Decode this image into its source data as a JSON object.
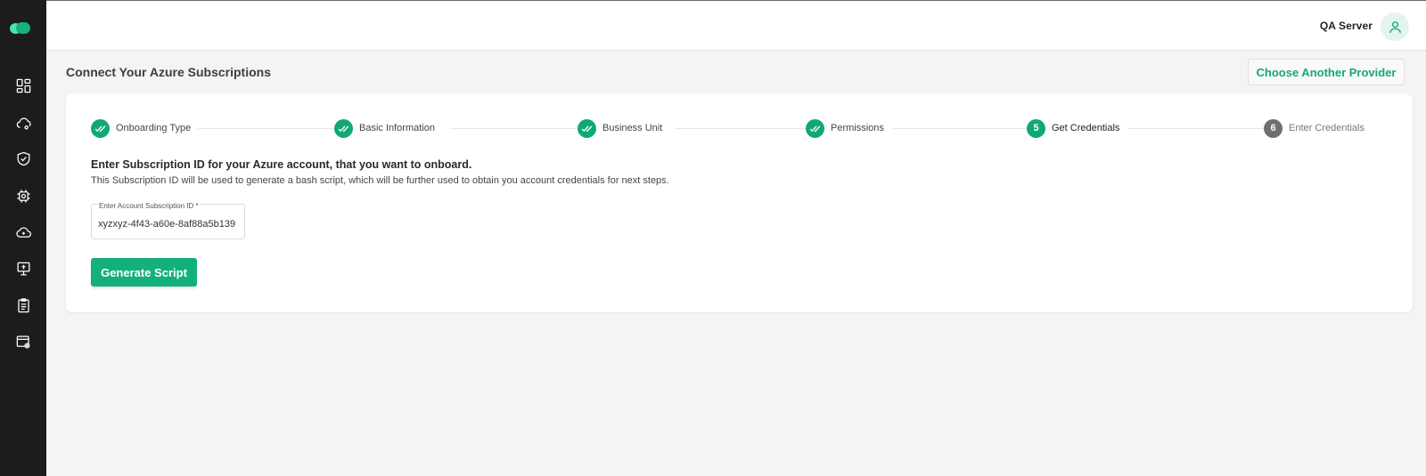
{
  "sidebar": {
    "logo": "cloud-logo",
    "items": [
      {
        "icon": "dashboard-icon"
      },
      {
        "icon": "cloud-settings-icon"
      },
      {
        "icon": "shield-check-icon"
      },
      {
        "icon": "chip-icon"
      },
      {
        "icon": "cloud-icon"
      },
      {
        "icon": "monitor-icon"
      },
      {
        "icon": "clipboard-icon"
      },
      {
        "icon": "window-settings-icon"
      }
    ]
  },
  "header": {
    "server": "QA Server",
    "avatar_icon": "user-icon"
  },
  "page": {
    "title": "Connect Your Azure Subscriptions",
    "provider_button": "Choose Another Provider"
  },
  "stepper": {
    "steps": [
      {
        "label": "Onboarding Type",
        "state": "done",
        "number": ""
      },
      {
        "label": "Basic Information",
        "state": "done",
        "number": ""
      },
      {
        "label": "Business Unit",
        "state": "done",
        "number": ""
      },
      {
        "label": "Permissions",
        "state": "done",
        "number": ""
      },
      {
        "label": "Get Credentials",
        "state": "active",
        "number": "5"
      },
      {
        "label": "Enter Credentials",
        "state": "pending",
        "number": "6"
      }
    ]
  },
  "form": {
    "heading": "Enter Subscription ID for your Azure account, that you want to onboard.",
    "description": "This Subscription ID will be used to generate a bash script, which will be further used to obtain you account credentials for next steps.",
    "field_label": "Enter Account Subscription ID *",
    "field_value": "xyzxyz-4f43-a60e-8af88a5b139",
    "submit_label": "Generate Script"
  },
  "colors": {
    "accent": "#11a877",
    "sidebar_bg": "#1c1c1c",
    "pending_step": "#6f6f6f"
  }
}
